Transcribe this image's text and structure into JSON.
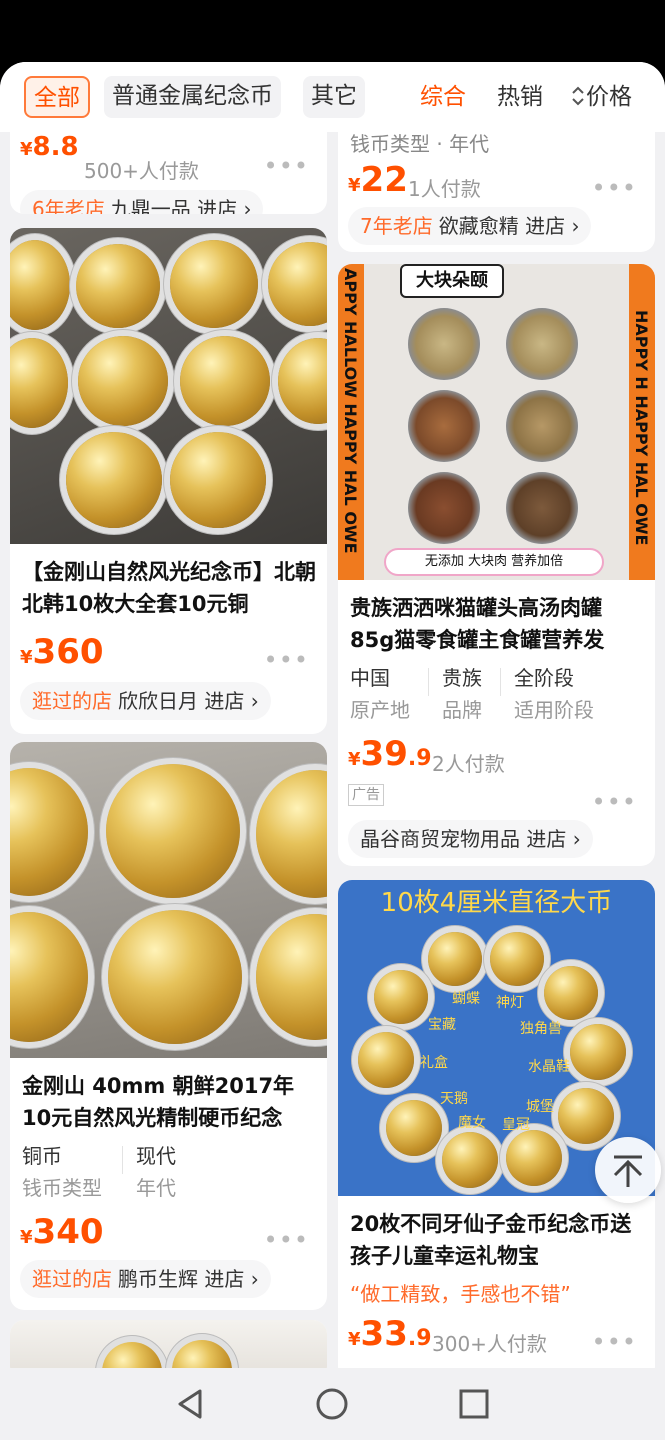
{
  "filter": {
    "chips": [
      "全部",
      "普通金属纪念币",
      "其它"
    ],
    "sorts": [
      "综合",
      "热销",
      "价格"
    ]
  },
  "cards": {
    "c1": {
      "price_cur": "¥",
      "price_num": "8.8",
      "paid": "500+人付款",
      "shop_tag": "6年老店",
      "shop_name": "九鼎一品",
      "shop_enter": "进店"
    },
    "c2": {
      "attr_text": "钱币类型  ·  年代",
      "price_cur": "¥",
      "price_num": "22",
      "paid": "1人付款",
      "shop_tag": "7年老店",
      "shop_name": "欲藏愈精",
      "shop_enter": "进店"
    },
    "c3": {
      "title": "【金刚山自然风光纪念币】北朝北韩10枚大全套10元铜",
      "price_cur": "¥",
      "price_num": "360",
      "shop_tag": "逛过的店",
      "shop_name": "欣欣日月",
      "shop_enter": "进店"
    },
    "c4": {
      "img_title": "大块朵颐",
      "img_banner_left": "APPY HALLOW HAPPY HAL OWE",
      "img_banner_right": "HAPPY H HAPPY HAL OWE",
      "img_bottom": "无添加  大块肉  营养加倍",
      "title": "贵族洒洒咪猫罐头高汤肉罐85g猫零食罐主食罐营养发",
      "attrs": [
        {
          "value": "中国",
          "key": "原产地"
        },
        {
          "value": "贵族",
          "key": "品牌"
        },
        {
          "value": "全阶段",
          "key": "适用阶段"
        }
      ],
      "price_cur": "¥",
      "price_num": "39",
      "price_dec": ".9",
      "paid": "2人付款",
      "ad": "广告",
      "shop_name": "晶谷商贸宠物用品",
      "shop_enter": "进店"
    },
    "c5": {
      "title": "金刚山 40mm 朝鲜2017年10元自然风光精制硬币纪念",
      "attrs": [
        {
          "value": "铜币",
          "key": "钱币类型"
        },
        {
          "value": "现代",
          "key": "年代"
        }
      ],
      "price_cur": "¥",
      "price_num": "340",
      "shop_tag": "逛过的店",
      "shop_name": "鹏币生辉",
      "shop_enter": "进店"
    },
    "c6": {
      "img_title": "10枚4厘米直径大币",
      "coin_labels": [
        "蝴蝶",
        "神灯",
        "宝藏",
        "独角兽",
        "礼盒",
        "水晶鞋",
        "天鹅",
        "城堡",
        "魔女",
        "皇冠"
      ],
      "title": "20枚不同牙仙子金币纪念币送孩子儿童幸运礼物宝",
      "quote": "“做工精致，手感也不错”",
      "price_cur": "¥",
      "price_num": "33",
      "price_dec": ".9",
      "paid": "300+人付款"
    }
  },
  "icons": {
    "more": "more-dots-icon",
    "chevron": "chevron-right-icon",
    "back_to_top": "arrow-up-icon",
    "nav": [
      "back-icon",
      "home-icon",
      "recents-icon"
    ]
  },
  "colors": {
    "accent": "#ff5000",
    "shop_highlight": "#ff6a2a",
    "coin_blue": "#3a73c7"
  }
}
